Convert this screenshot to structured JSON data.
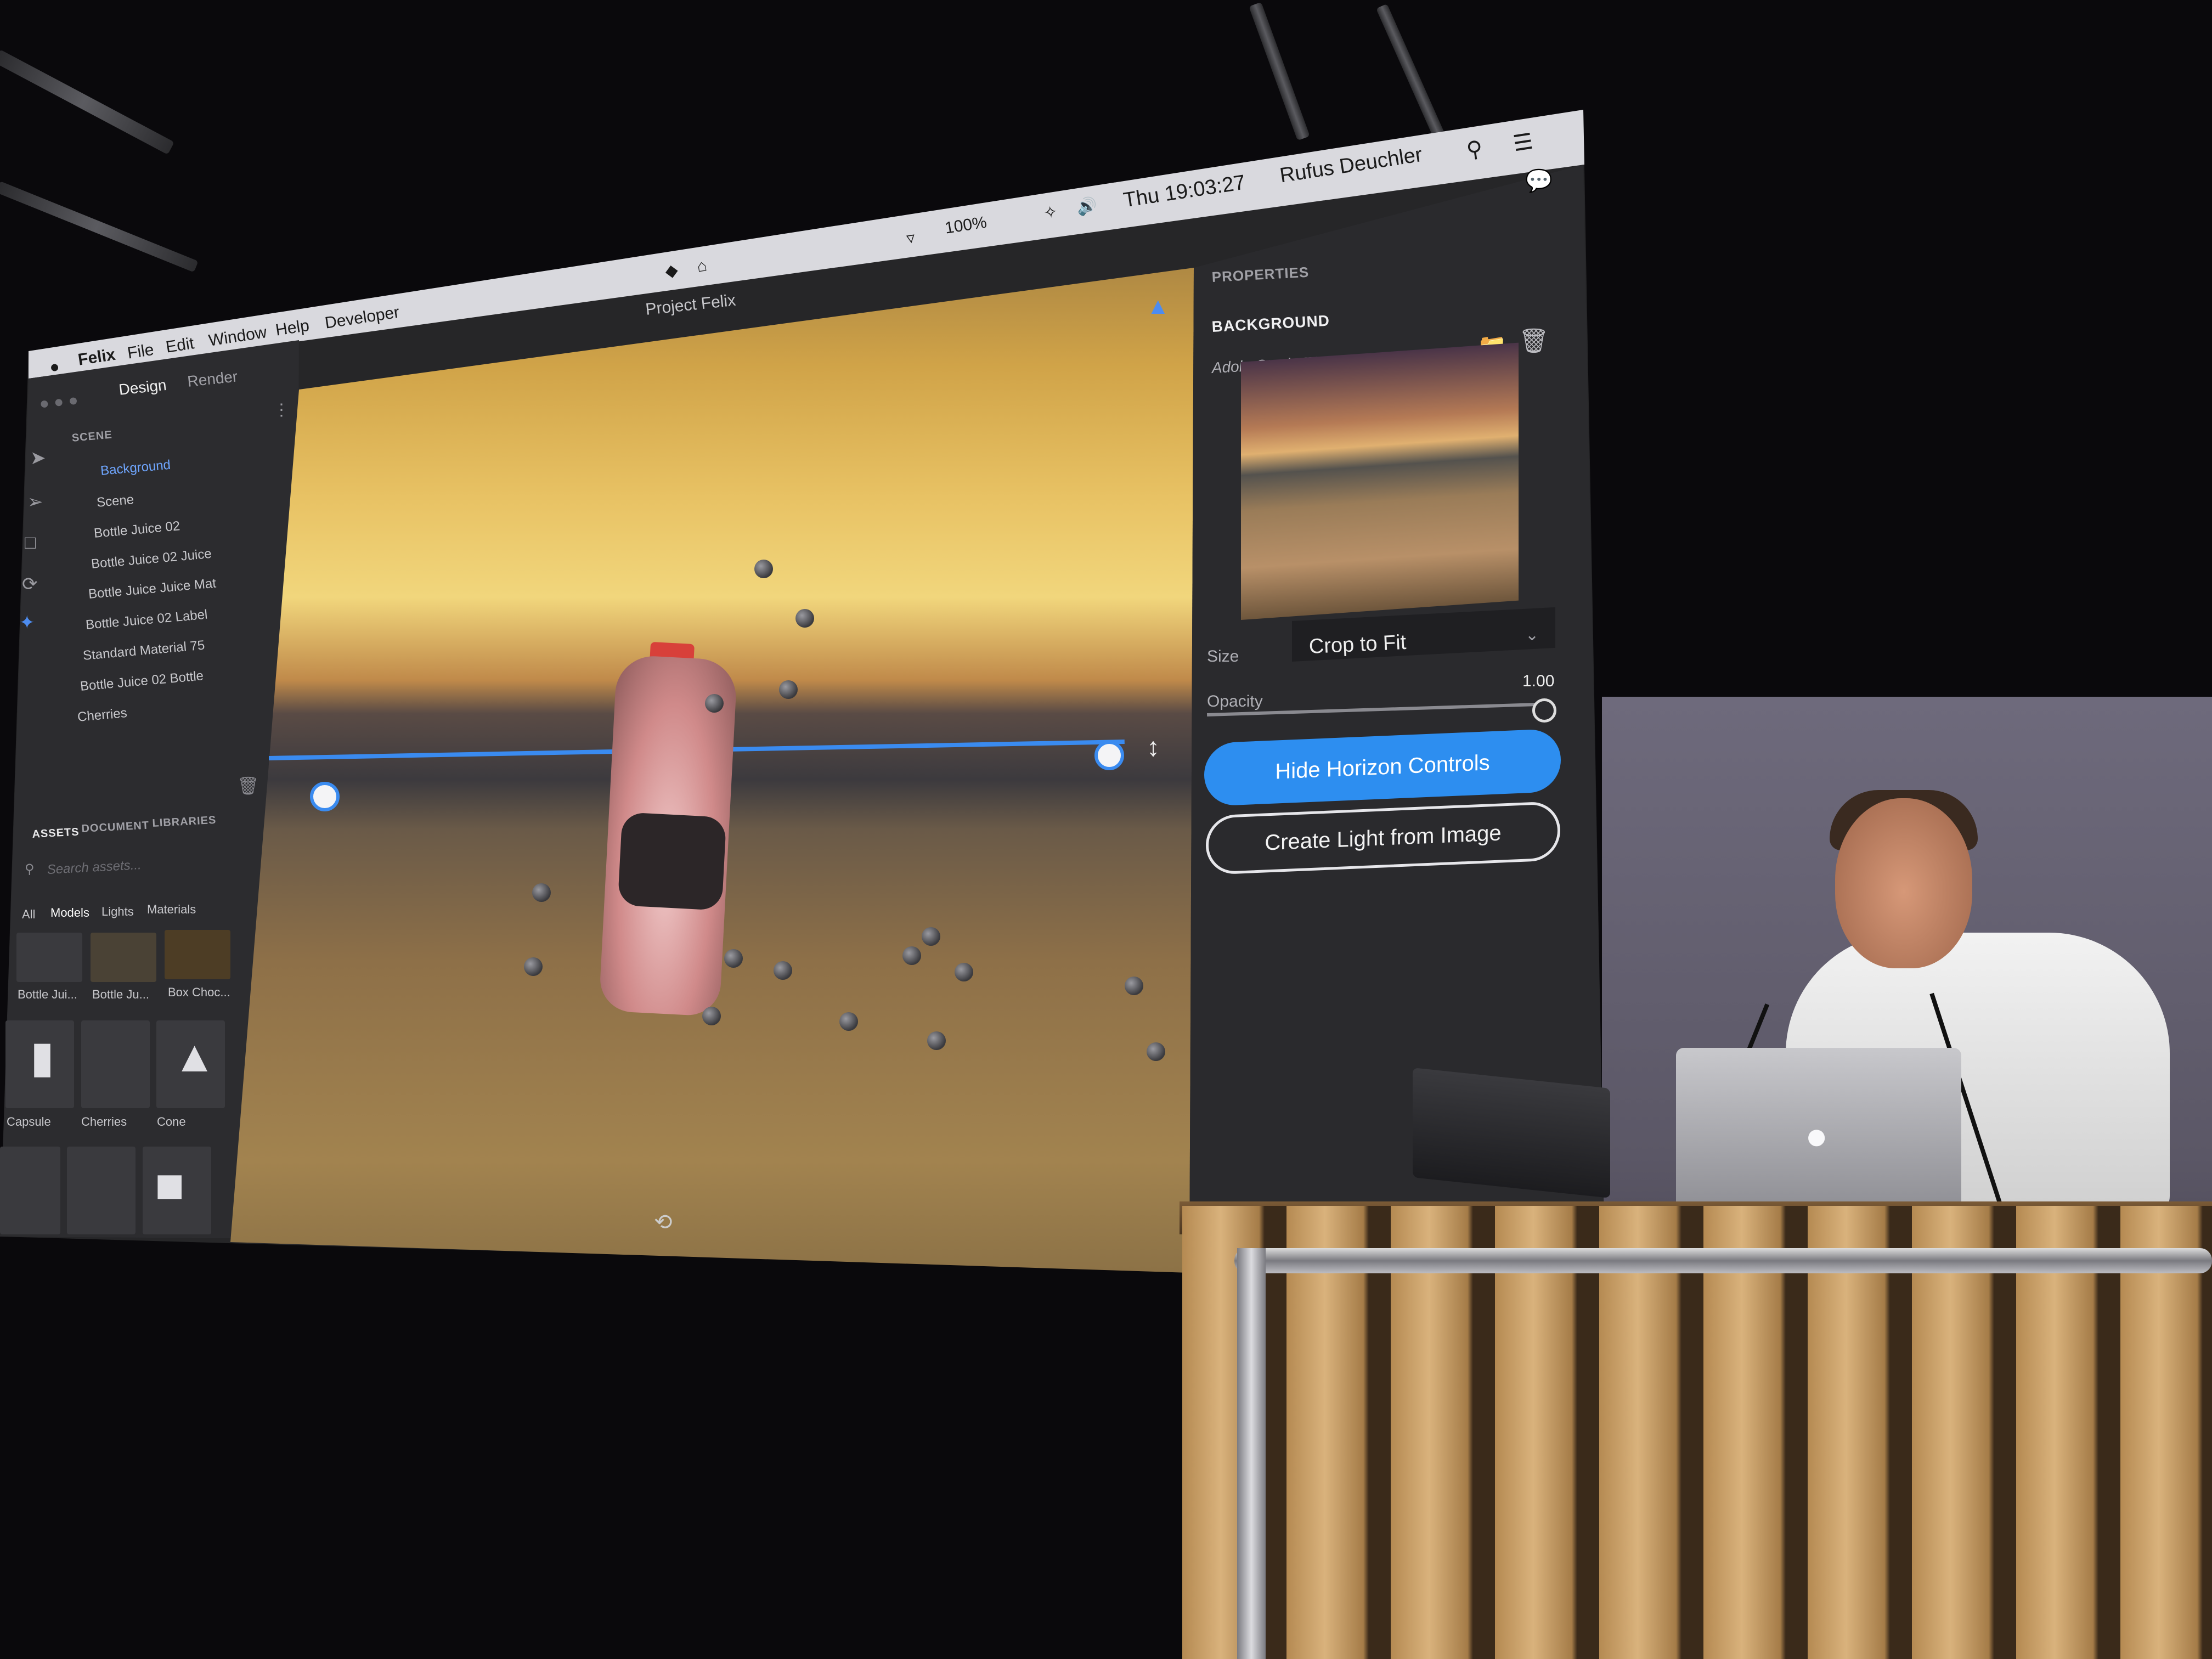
{
  "menubar": {
    "apple": "",
    "app_name": "Felix",
    "menus": [
      "File",
      "Edit",
      "Window",
      "Help",
      "Developer"
    ],
    "battery": "100%",
    "clock": "Thu 19:03:27",
    "user": "Rufus Deuchler"
  },
  "window": {
    "title": "Project Felix"
  },
  "left_panel": {
    "tabs": [
      "Design",
      "Render"
    ],
    "scene_header": "SCENE",
    "tree": [
      "Background",
      "Scene",
      "Bottle Juice 02",
      "Bottle Juice 02 Juice",
      "Bottle Juice Juice Mat",
      "Bottle Juice 02 Label",
      "Standard Material 75",
      "Bottle Juice 02 Bottle",
      "Cherries"
    ],
    "asset_tabs": [
      "ASSETS",
      "DOCUMENT",
      "LIBRARIES"
    ],
    "search_placeholder": "Search assets...",
    "filters": [
      "All",
      "Models",
      "Lights",
      "Materials"
    ],
    "thumbs": [
      "Bottle Jui...",
      "Bottle Ju...",
      "Box Choc...",
      "Capsule",
      "Cherries",
      "Cone"
    ]
  },
  "properties": {
    "header": "PROPERTIES",
    "section": "BACKGROUND",
    "filename": "AdobeStock_78190597.jpeg",
    "size_label": "Size",
    "size_value": "Crop to Fit",
    "opacity_label": "Opacity",
    "opacity_value": "1.00",
    "opacity_level": 1.0,
    "primary_button": "Hide Horizon Controls",
    "secondary_button": "Create Light from Image"
  },
  "colors": {
    "accent": "#2d8ef0",
    "panel": "#2a2a2d"
  }
}
